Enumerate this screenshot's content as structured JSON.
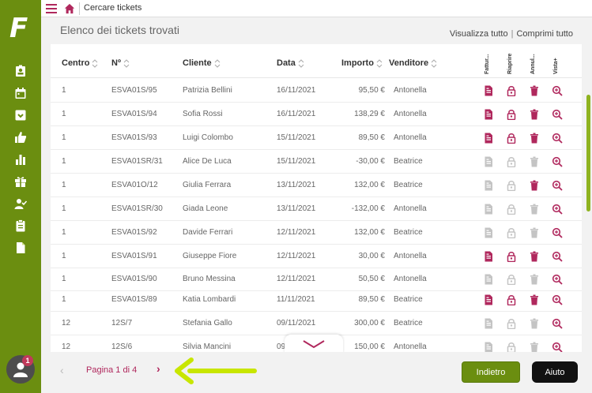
{
  "app": {
    "logo_text": "F"
  },
  "topbar": {
    "title": "Cercare tickets"
  },
  "page": {
    "title": "Elenco dei tickets trovati",
    "view_all": "Visualizza tutto",
    "collapse_all": "Comprimi tutto",
    "separator": "|"
  },
  "table": {
    "headers": {
      "centro": "Centro",
      "numero": "Nº",
      "cliente": "Cliente",
      "data": "Data",
      "importo": "Importo",
      "venditore": "Venditore",
      "fattura": "Fattur...",
      "riaprire": "Riaprire",
      "annulla": "Annul...",
      "vista": "Vista+"
    },
    "rows": [
      {
        "centro": "1",
        "numero": "ESVA01S/95",
        "cliente": "Patrizia Bellini",
        "data": "16/11/2021",
        "importo": "95,50 €",
        "venditore": "Antonella",
        "active": true
      },
      {
        "centro": "1",
        "numero": "ESVA01S/94",
        "cliente": "Sofia Rossi",
        "data": "16/11/2021",
        "importo": "138,29 €",
        "venditore": "Antonella",
        "active": true
      },
      {
        "centro": "1",
        "numero": "ESVA01S/93",
        "cliente": "Luigi Colombo",
        "data": "15/11/2021",
        "importo": "89,50 €",
        "venditore": "Antonella",
        "active": true
      },
      {
        "centro": "1",
        "numero": "ESVA01SR/31",
        "cliente": "Alice De Luca",
        "data": "15/11/2021",
        "importo": "-30,00 €",
        "venditore": "Beatrice",
        "active": false
      },
      {
        "centro": "1",
        "numero": "ESVA01O/12",
        "cliente": "Giulia Ferrara",
        "data": "13/11/2021",
        "importo": "132,00 €",
        "venditore": "Beatrice",
        "active": false
      },
      {
        "centro": "1",
        "numero": "ESVA01SR/30",
        "cliente": "Giada Leone",
        "data": "13/11/2021",
        "importo": "-132,00 €",
        "venditore": "Antonella",
        "active": false
      },
      {
        "centro": "1",
        "numero": "ESVA01S/92",
        "cliente": "Davide Ferrari",
        "data": "12/11/2021",
        "importo": "132,00 €",
        "venditore": "Beatrice",
        "active": false
      },
      {
        "centro": "1",
        "numero": "ESVA01S/91",
        "cliente": "Giuseppe Fiore",
        "data": "12/11/2021",
        "importo": "30,00 €",
        "venditore": "Antonella",
        "active": true
      },
      {
        "centro": "1",
        "numero": "ESVA01S/90",
        "cliente": "Bruno Messina",
        "data": "12/11/2021",
        "importo": "50,50 €",
        "venditore": "Antonella",
        "active": false
      },
      {
        "centro": "1",
        "numero": "ESVA01S/89",
        "cliente": "Katia Lombardi",
        "data": "11/11/2021",
        "importo": "89,50 €",
        "venditore": "Beatrice",
        "active": true
      },
      {
        "centro": "12",
        "numero": "12S/7",
        "cliente": "Stefania Gallo",
        "data": "09/11/2021",
        "importo": "300,00 €",
        "venditore": "Beatrice",
        "active": false
      },
      {
        "centro": "12",
        "numero": "12S/6",
        "cliente": "Silvia Mancini",
        "data": "09",
        "importo": "150,00 €",
        "venditore": "Antonella",
        "active": false
      }
    ]
  },
  "pagination": {
    "label": "Pagina 1 di 4",
    "prev": "‹",
    "next": "›"
  },
  "buttons": {
    "back": "Indietro",
    "help": "Aiuto"
  },
  "user": {
    "notification_count": "1"
  },
  "colors": {
    "brand_green": "#6b8e10",
    "accent_magenta": "#b0285d",
    "arrow_yellow": "#c8e600"
  }
}
